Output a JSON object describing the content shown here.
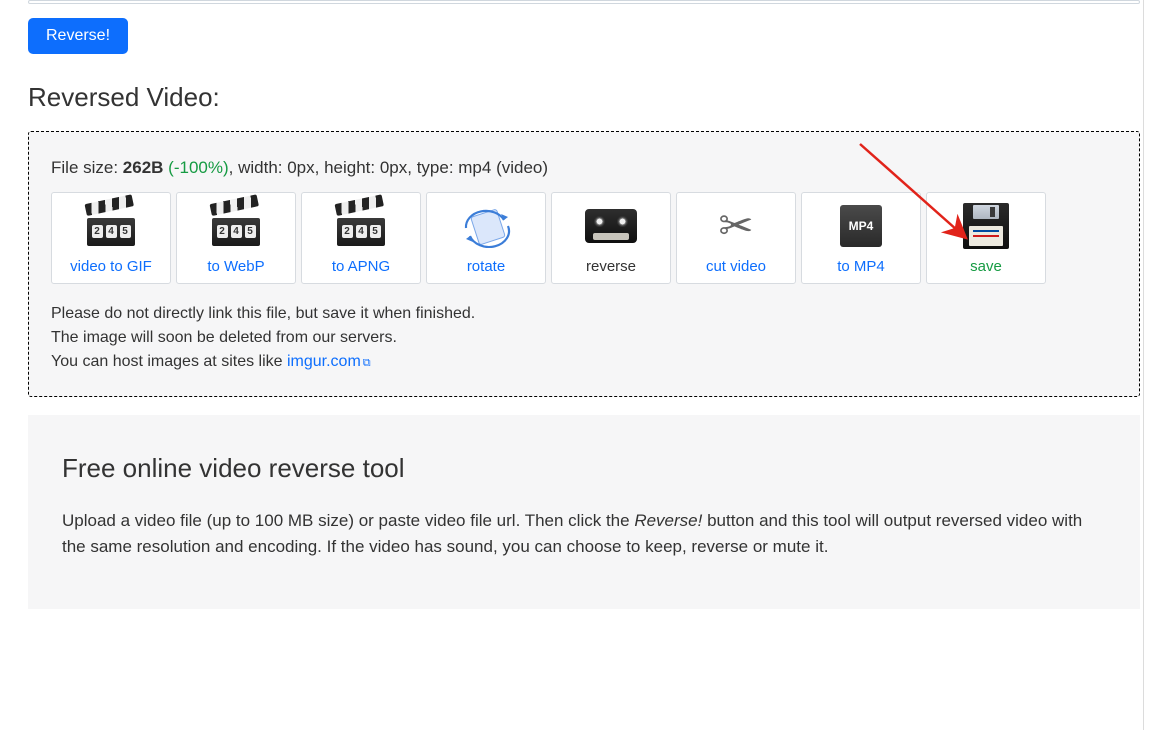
{
  "reverseBtn": "Reverse!",
  "sectionTitle": "Reversed Video:",
  "file": {
    "sizeLabel": "File size: ",
    "sizeValue": "262B",
    "percent": "(-100%)",
    "rest": ", width: 0px, height: 0px, type: mp4 (video)"
  },
  "tiles": [
    {
      "label": "video to GIF",
      "type": "clapper"
    },
    {
      "label": "to WebP",
      "type": "clapper"
    },
    {
      "label": "to APNG",
      "type": "clapper"
    },
    {
      "label": "rotate",
      "type": "rotate"
    },
    {
      "label": "reverse",
      "type": "cassette",
      "active": true
    },
    {
      "label": "cut video",
      "type": "scissors"
    },
    {
      "label": "to MP4",
      "type": "mp4"
    },
    {
      "label": "save",
      "type": "floppy",
      "save": true
    }
  ],
  "notes": {
    "line1": "Please do not directly link this file, but save it when finished.",
    "line2": "The image will soon be deleted from our servers.",
    "line3a": "You can host images at sites like ",
    "linkText": "imgur.com",
    "extGlyph": "⧉"
  },
  "info": {
    "heading": "Free online video reverse tool",
    "p1a": "Upload a video file (up to 100 MB size) or paste video file url. Then click the ",
    "p1em": "Reverse!",
    "p1b": " button and this tool will output reversed video with the same resolution and encoding. If the video has sound, you can choose to keep, reverse or mute it."
  },
  "clapperNums": [
    "2",
    "4",
    "5"
  ]
}
